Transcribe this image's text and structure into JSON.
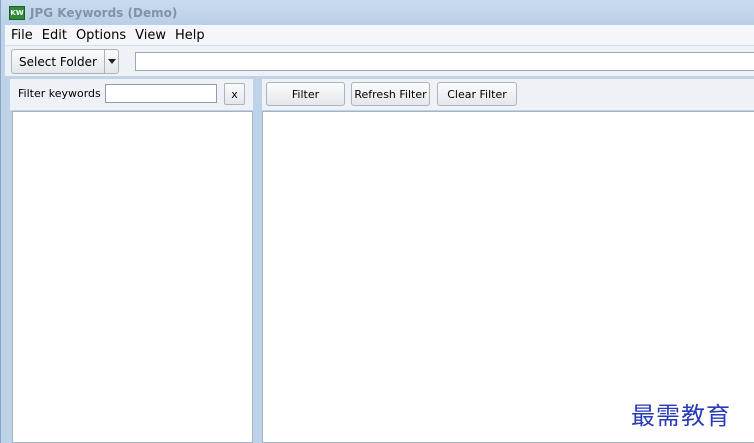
{
  "window": {
    "title": "JPG Keywords (Demo)",
    "icon_text": "KW"
  },
  "menu": [
    "File",
    "Edit",
    "Options",
    "View",
    "Help"
  ],
  "toolbar": {
    "select_folder_label": "Select Folder",
    "path_value": ""
  },
  "left_panel": {
    "filter_label": "Filter keywords",
    "filter_value": "",
    "clear_label": "x"
  },
  "right_panel": {
    "filter_label": "Filter",
    "refresh_label": "Refresh Filter",
    "clear_label": "Clear Filter"
  },
  "watermark": "最需教育",
  "colors": {
    "title_text": "#7f93ab",
    "icon_bg": "#2e8b3a",
    "watermark": "#2a3bb8",
    "chrome": "#bfd3e8"
  }
}
